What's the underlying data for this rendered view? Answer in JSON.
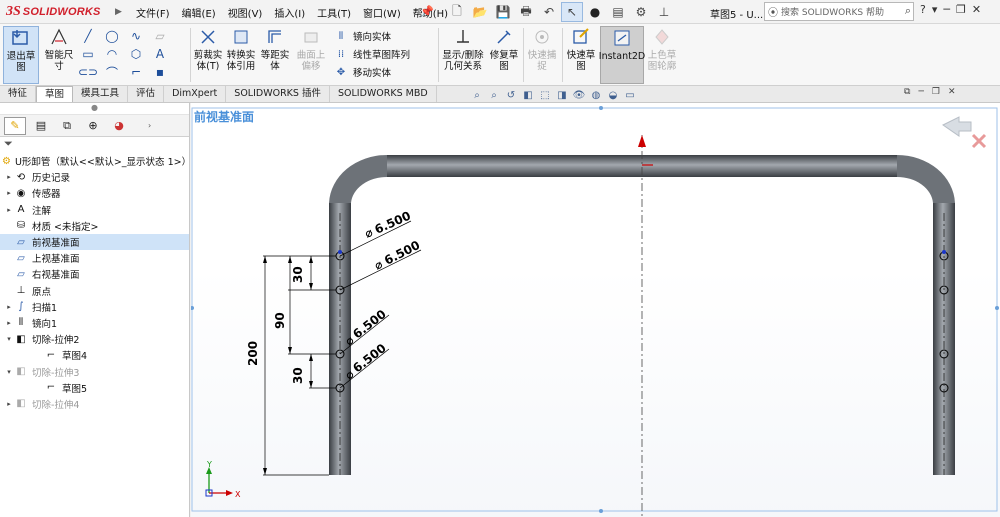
{
  "app": {
    "logo_prefix": "3S",
    "logo_text": "SOLIDWORKS",
    "menus": [
      "文件(F)",
      "编辑(E)",
      "视图(V)",
      "插入(I)",
      "工具(T)",
      "窗口(W)",
      "帮助(H)"
    ],
    "doc_title": "草图5 - U...",
    "search_placeholder": "搜索 SOLIDWORKS 帮助",
    "help_btn": "?"
  },
  "ribbon": {
    "exit_sketch": "退出草\n图",
    "smart_dim": "智能尺\n寸",
    "trim": "剪裁实\n体(T)",
    "convert": "转换实\n体引用",
    "offset": "等距实\n体",
    "surface_offset": "曲面上\n偏移",
    "mirror": "镜向实体",
    "linear_pattern": "线性草图阵列",
    "move": "移动实体",
    "display_delete_rel": "显示/删除\n几何关系",
    "repair": "修复草\n图",
    "quick_snaps_dim": "快速捕\n捉",
    "quick_sketch": "快速草\n图",
    "instant2d": "Instant2D",
    "shaded": "上色草\n图轮廓"
  },
  "tabs": [
    "特征",
    "草图",
    "模具工具",
    "评估",
    "DimXpert",
    "SOLIDWORKS 插件",
    "SOLIDWORKS MBD"
  ],
  "active_tab_index": 1,
  "tree": {
    "root": "U形卸管（默认<<默认>_显示状态 1>）",
    "items": [
      {
        "label": "历史记录",
        "icon": "history-icon"
      },
      {
        "label": "传感器",
        "icon": "sensor-icon"
      },
      {
        "label": "注解",
        "icon": "annotation-icon"
      },
      {
        "label": "材质 <未指定>",
        "icon": "material-icon"
      },
      {
        "label": "前视基准面",
        "icon": "plane-icon",
        "selected": true
      },
      {
        "label": "上视基准面",
        "icon": "plane-icon"
      },
      {
        "label": "右视基准面",
        "icon": "plane-icon"
      },
      {
        "label": "原点",
        "icon": "origin-icon"
      },
      {
        "label": "扫描1",
        "icon": "sweep-icon"
      },
      {
        "label": "镜向1",
        "icon": "mirror-icon"
      },
      {
        "label": "切除-拉伸2",
        "icon": "cut-extrude-icon"
      },
      {
        "label": "草图4",
        "icon": "sketch-icon"
      },
      {
        "label": "切除-拉伸3",
        "icon": "cut-extrude-icon",
        "dim": true
      },
      {
        "label": "草图5",
        "icon": "sketch-icon"
      },
      {
        "label": "切除-拉伸4",
        "icon": "cut-extrude-icon",
        "dim": true
      }
    ]
  },
  "graphics": {
    "plane_label": "前视基准面",
    "dimensions": {
      "dia_1": "6.500",
      "dia_2": "6.500",
      "dia_3": "6.500",
      "dia_4": "6.500",
      "dist_30_top": "30",
      "dist_90": "90",
      "dist_30_bottom": "30",
      "dist_200": "200"
    },
    "axis_x": "X",
    "axis_y": "Y"
  },
  "colors": {
    "accent": "#2a6acf",
    "logo_red": "#d11f2b",
    "pipe_dark": "#4b4f54",
    "pipe_light": "#9aa0a6",
    "selection_blue": "#cfe3f8",
    "centerline_red": "#cc0000"
  }
}
